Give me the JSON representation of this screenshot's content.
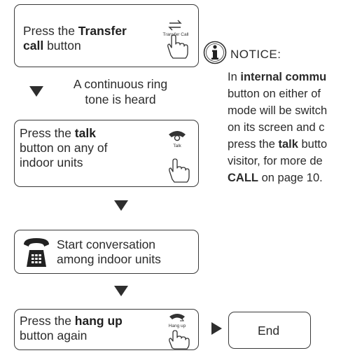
{
  "step1": {
    "text_pre": "Press the ",
    "text_bold": "Transfer",
    "text_bold2": "call",
    "text_post": " button",
    "icon": "transfer-call-hand-icon",
    "icon_label": "Transfer Call"
  },
  "ring_note": {
    "line1": "A continuous ring",
    "line2": "tone is heard"
  },
  "step2": {
    "text_pre": "Press the ",
    "text_bold": "talk",
    "line2": "button on any of",
    "line3": "indoor units",
    "icon": "talk-handset-hand-icon",
    "icon_label": "Talk"
  },
  "step3": {
    "line1": "Start conversation",
    "line2": "among indoor units",
    "icon": "telephone-icon"
  },
  "step4": {
    "text_pre": "Press the ",
    "text_bold": "hang up",
    "line2": "button again",
    "icon": "hang-up-handset-hand-icon",
    "icon_label": "Hang up"
  },
  "end": {
    "label": "End"
  },
  "notice": {
    "icon": "info-icon",
    "title": "NOTICE:",
    "l1_pre": "In ",
    "l1_bold": "internal commu",
    "l2": "button on either of",
    "l3": "mode will be switch",
    "l4": "on its screen and c",
    "l5_pre": "press the ",
    "l5_bold": "talk",
    "l5_post": " butto",
    "l6": "visitor, for more de",
    "l7_bold": "CALL",
    "l7_post": " on page 10."
  }
}
